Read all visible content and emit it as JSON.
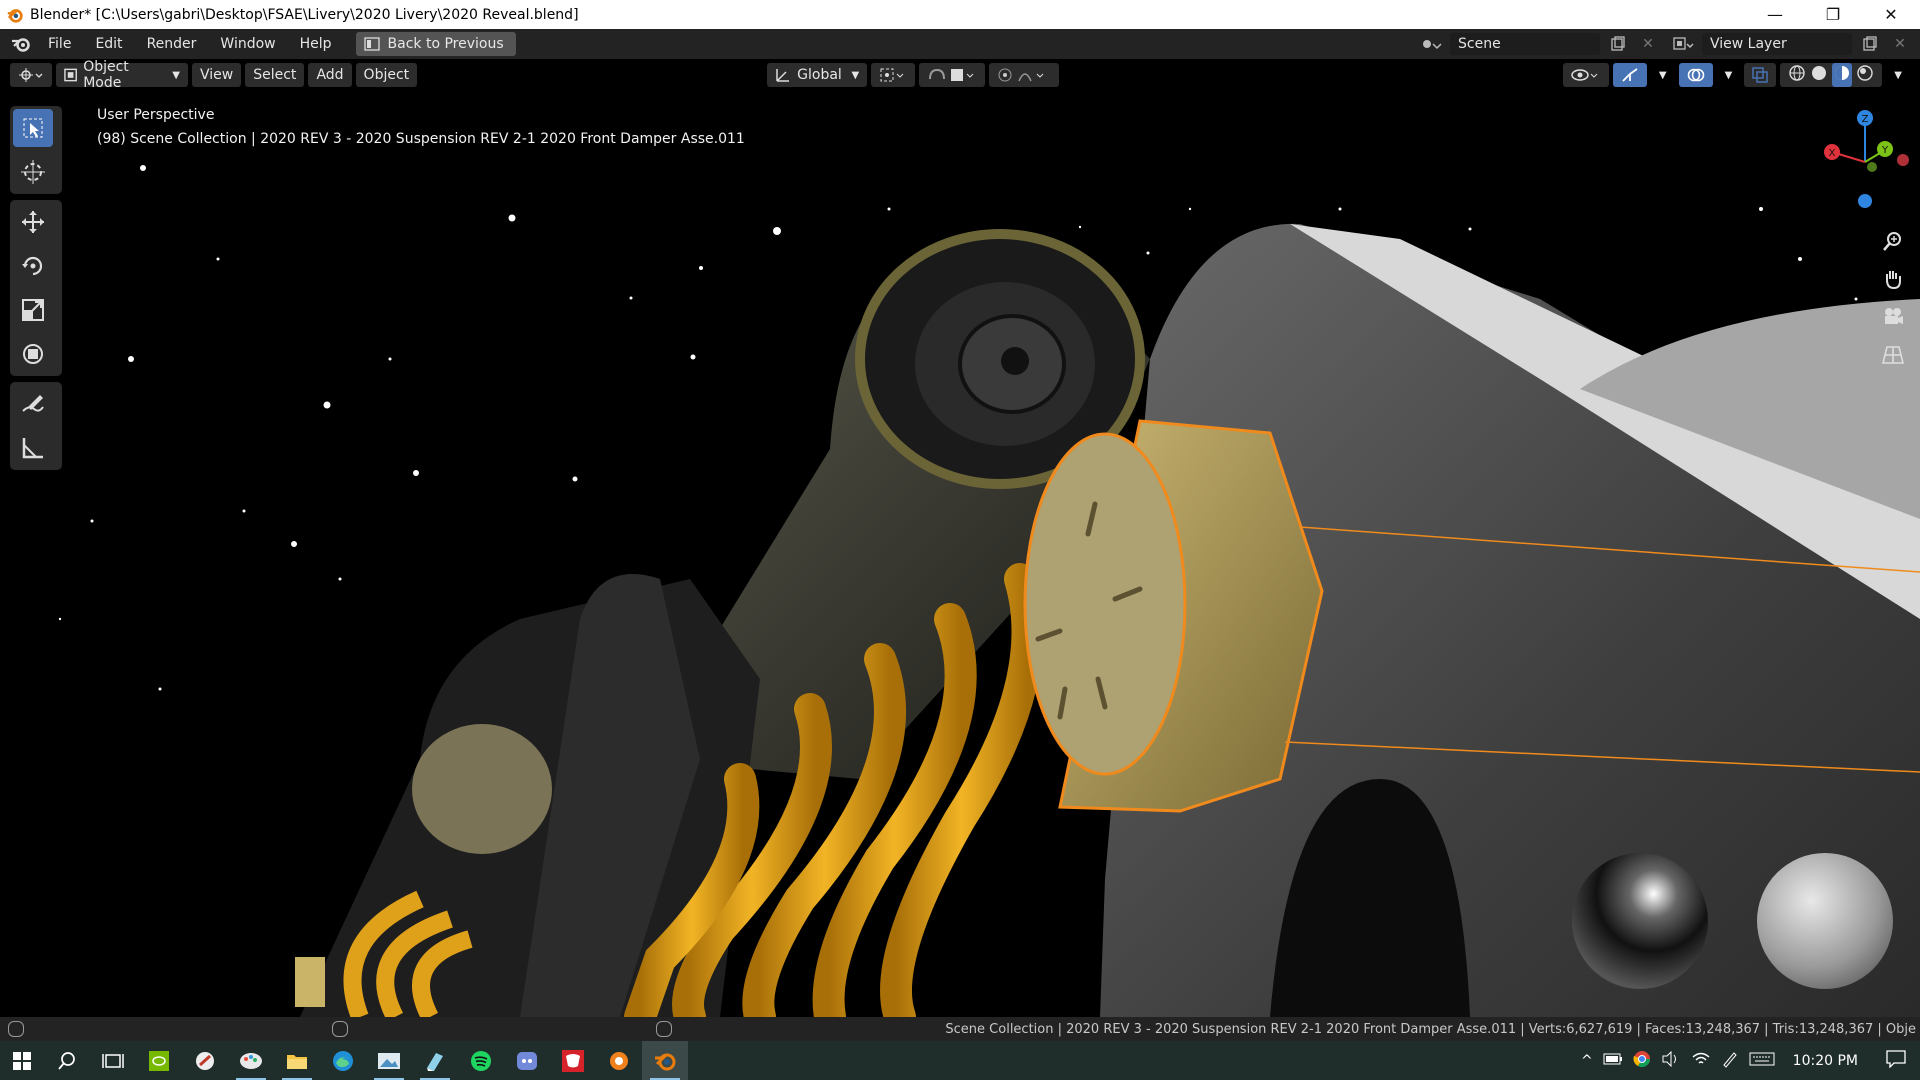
{
  "window": {
    "title": "Blender* [C:\\Users\\gabri\\Desktop\\FSAE\\Livery\\2020 Livery\\2020 Reveal.blend]",
    "minimize": "—",
    "maximize": "❐",
    "close": "✕"
  },
  "menubar": {
    "items": [
      "File",
      "Edit",
      "Render",
      "Window",
      "Help"
    ],
    "back_button": "Back to Previous",
    "scene_label": "Scene",
    "view_layer_label": "View Layer"
  },
  "viewport_header": {
    "mode": "Object Mode",
    "menus": [
      "View",
      "Select",
      "Add",
      "Object"
    ],
    "transform_orientation": "Global"
  },
  "viewport": {
    "perspective": "User Perspective",
    "collection_info": "(98) Scene Collection | 2020 REV 3 - 2020 Suspension REV 2-1 2020 Front Damper Asse.011",
    "gizmo_axes": {
      "x": "X",
      "y": "Y",
      "z": "Z"
    },
    "colors": {
      "selection": "#f08a1c",
      "spring": "#e0a11a",
      "bolt": "#b4a05a",
      "part": "#5a5a5a",
      "axis_x": "#e0323c",
      "axis_y": "#7cc217",
      "axis_z": "#2f86e0"
    }
  },
  "statusbar": {
    "stats": "Scene Collection | 2020 REV 3 - 2020 Suspension REV 2-1 2020 Front Damper Asse.011 | Verts:6,627,619 | Faces:13,248,367 | Tris:13,248,367 | Obje"
  },
  "taskbar": {
    "time": "10:20 PM",
    "apps": [
      "start-icon",
      "search-icon",
      "task-view-icon",
      "nvidia-icon",
      "app-icon",
      "paint-icon",
      "file-explorer-icon",
      "edge-icon",
      "photos-icon",
      "notes-icon",
      "spotify-icon",
      "discord-icon",
      "solidworks-icon",
      "blender-orange-icon",
      "blender-icon"
    ]
  }
}
